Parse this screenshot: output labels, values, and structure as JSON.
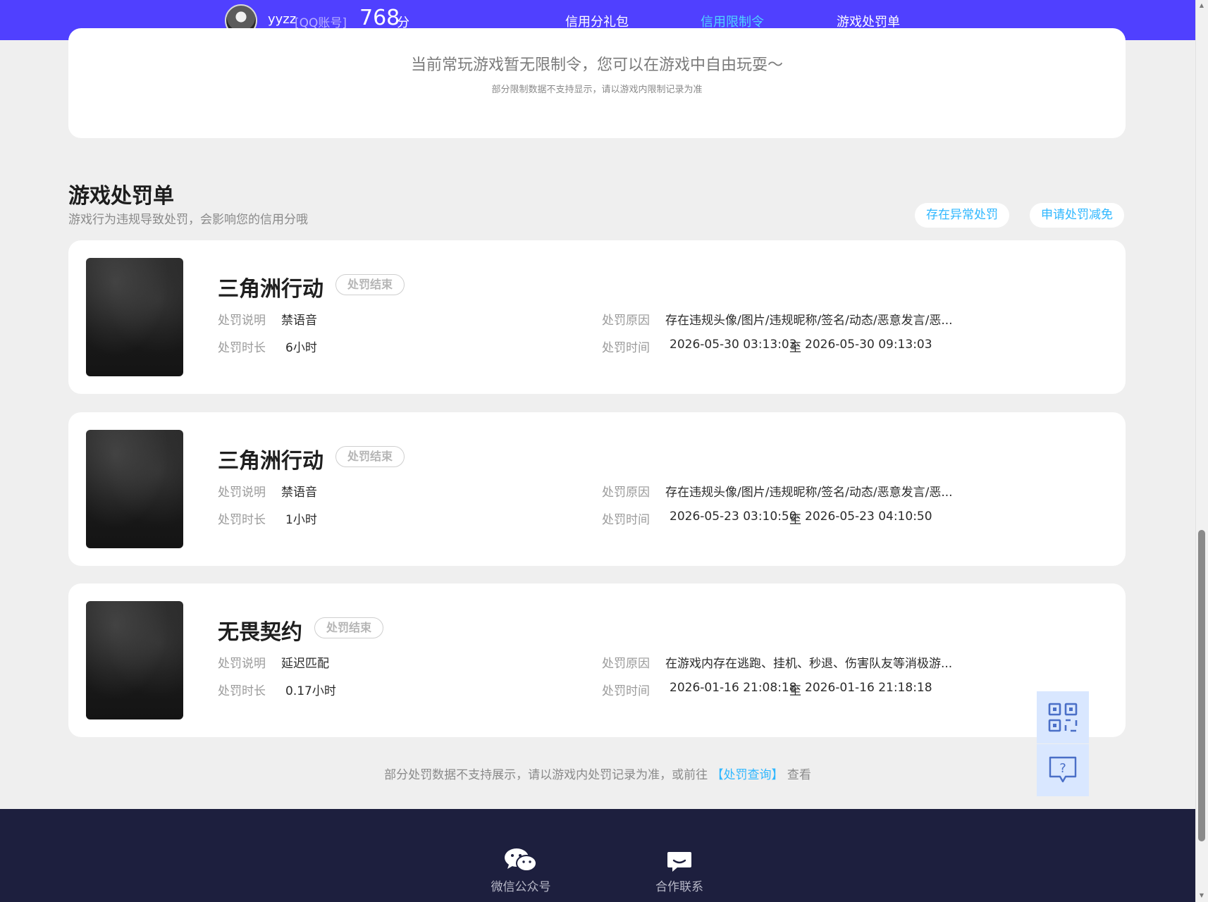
{
  "nav": {
    "username": "yyzz",
    "account_type": "[QQ账号]",
    "score_value": "768",
    "score_unit": "分",
    "tabs": [
      {
        "label": "信用分礼包",
        "active": false
      },
      {
        "label": "信用限制令",
        "active": true
      },
      {
        "label": "游戏处罚单",
        "active": false
      }
    ],
    "active_color": "#4fd2ff",
    "bar_color": "#5040ff"
  },
  "restriction": {
    "message": "当前常玩游戏暂无限制令，您可以在游戏中自由玩耍～",
    "note": "部分限制数据不支持显示，请以游戏内限制记录为准"
  },
  "punishments": {
    "title": "游戏处罚单",
    "subtitle": "游戏行为违规导致处罚，会影响您的信用分哦",
    "buttons": {
      "abnormal": "存在异常处罚",
      "reduction": "申请处罚减免"
    },
    "labels": {
      "description": "处罚说明",
      "duration": "处罚时长",
      "reason": "处罚原因",
      "time": "处罚时间",
      "to": "至"
    },
    "items": [
      {
        "game": "三角洲行动",
        "status": "处罚结束",
        "description": "禁语音",
        "duration": "6小时",
        "reason": "存在违规头像/图片/违规昵称/签名/动态/恶意发言/恶...",
        "time_start": "2026-05-30 03:13:03",
        "time_end": "2026-05-30 09:13:03"
      },
      {
        "game": "三角洲行动",
        "status": "处罚结束",
        "description": "禁语音",
        "duration": "1小时",
        "reason": "存在违规头像/图片/违规昵称/签名/动态/恶意发言/恶...",
        "time_start": "2026-05-23 03:10:50",
        "time_end": "2026-05-23 04:10:50"
      },
      {
        "game": "无畏契约",
        "status": "处罚结束",
        "description": "延迟匹配",
        "duration": "0.17小时",
        "reason": "在游戏内存在逃跑、挂机、秒退、伤害队友等消极游...",
        "time_start": "2026-01-16 21:08:18",
        "time_end": "2026-01-16 21:18:18"
      }
    ],
    "footnote_before": "部分处罚数据不支持展示，请以游戏内处罚记录为准，或前往",
    "footnote_link": "【处罚查询】",
    "footnote_after": "查看"
  },
  "floating": {
    "qr_icon": "qr-code-icon",
    "help_icon": "question-chat-icon"
  },
  "footer": {
    "items": [
      {
        "label": "微信公众号",
        "icon": "wechat-icon"
      },
      {
        "label": "合作联系",
        "icon": "message-icon"
      }
    ]
  }
}
